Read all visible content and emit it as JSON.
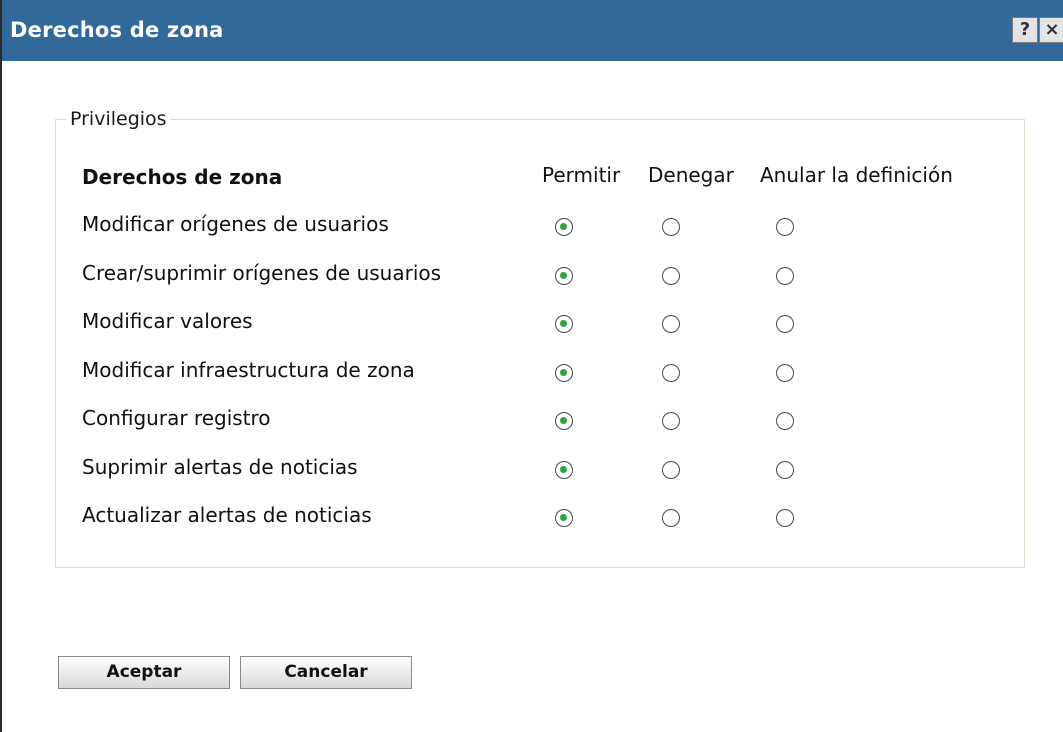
{
  "dialog": {
    "title": "Derechos de zona",
    "help_label": "?",
    "close_label": "×"
  },
  "privileges": {
    "legend": "Privilegios",
    "header_label": "Derechos de zona",
    "columns": [
      "Permitir",
      "Denegar",
      "Anular la definición"
    ],
    "rows": [
      {
        "label": "Modificar orígenes de usuarios",
        "selected": "Permitir"
      },
      {
        "label": "Crear/suprimir orígenes de usuarios",
        "selected": "Permitir"
      },
      {
        "label": "Modificar valores",
        "selected": "Permitir"
      },
      {
        "label": "Modificar infraestructura de zona",
        "selected": "Permitir"
      },
      {
        "label": "Configurar registro",
        "selected": "Permitir"
      },
      {
        "label": "Suprimir alertas de noticias",
        "selected": "Permitir"
      },
      {
        "label": "Actualizar alertas de noticias",
        "selected": "Permitir"
      }
    ]
  },
  "buttons": {
    "ok_label": "Aceptar",
    "cancel_label": "Cancelar"
  },
  "colors": {
    "titlebar": "#30699a",
    "radio_checked": "#2ea43a"
  }
}
